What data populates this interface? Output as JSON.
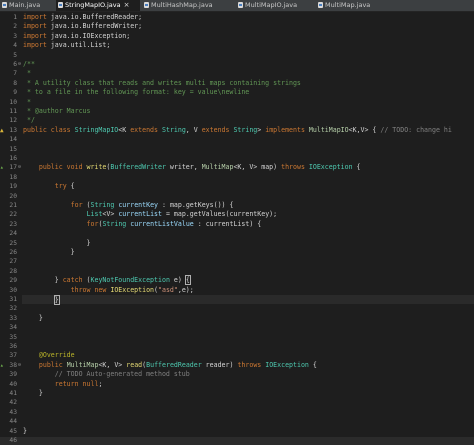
{
  "tabs": [
    {
      "label": "Main.java",
      "active": false
    },
    {
      "label": "StringMapIO.java",
      "active": true
    },
    {
      "label": "MultiHashMap.java",
      "active": false
    },
    {
      "label": "MultiMapIO.java",
      "active": false
    },
    {
      "label": "MultiMap.java",
      "active": false
    }
  ],
  "lines": [
    {
      "n": "1",
      "segs": [
        [
          "kw",
          "import "
        ],
        [
          "t",
          "java.io.BufferedReader;"
        ]
      ]
    },
    {
      "n": "2",
      "segs": [
        [
          "kw",
          "import "
        ],
        [
          "t",
          "java.io.BufferedWriter;"
        ]
      ]
    },
    {
      "n": "3",
      "segs": [
        [
          "kw",
          "import "
        ],
        [
          "t",
          "java.io.IOException;"
        ]
      ]
    },
    {
      "n": "4",
      "segs": [
        [
          "kw",
          "import "
        ],
        [
          "t",
          "java.util.List;"
        ]
      ]
    },
    {
      "n": "5",
      "segs": []
    },
    {
      "n": "6",
      "segs": [
        [
          "jd",
          "/**"
        ]
      ]
    },
    {
      "n": "7",
      "segs": [
        [
          "jd",
          " *"
        ]
      ]
    },
    {
      "n": "8",
      "segs": [
        [
          "jd",
          " * A utility class that reads and writes multi maps containing strings"
        ]
      ]
    },
    {
      "n": "9",
      "segs": [
        [
          "jd",
          " * to a file in the following format: key = value\\newline"
        ]
      ]
    },
    {
      "n": "10",
      "segs": [
        [
          "jd",
          " *"
        ]
      ]
    },
    {
      "n": "11",
      "segs": [
        [
          "jd",
          " * @author Marcus"
        ]
      ]
    },
    {
      "n": "12",
      "segs": [
        [
          "jd",
          " */"
        ]
      ]
    },
    {
      "n": "13",
      "segs": [
        [
          "kw",
          "public class "
        ],
        [
          "cl",
          "StringMapIO"
        ],
        [
          "t",
          "<K "
        ],
        [
          "kw",
          "extends "
        ],
        [
          "cl",
          "String"
        ],
        [
          "t",
          ", V "
        ],
        [
          "kw",
          "extends "
        ],
        [
          "cl",
          "String"
        ],
        [
          "t",
          "> "
        ],
        [
          "kw",
          "implements "
        ],
        [
          "cl2",
          "MultiMapIO"
        ],
        [
          "t",
          "<K,V> { "
        ],
        [
          "cm",
          "// TODO: change hi"
        ]
      ]
    },
    {
      "n": "14",
      "segs": []
    },
    {
      "n": "15",
      "segs": []
    },
    {
      "n": "16",
      "segs": []
    },
    {
      "n": "17",
      "segs": [
        [
          "t",
          "    "
        ],
        [
          "kw",
          "public void "
        ],
        [
          "fn",
          "write"
        ],
        [
          "t",
          "("
        ],
        [
          "cl",
          "BufferedWriter"
        ],
        [
          "t",
          " writer, "
        ],
        [
          "cl2",
          "MultiMap"
        ],
        [
          "t",
          "<K, V> map) "
        ],
        [
          "kw",
          "throws "
        ],
        [
          "cl",
          "IOException"
        ],
        [
          "t",
          " {"
        ]
      ]
    },
    {
      "n": "18",
      "segs": []
    },
    {
      "n": "19",
      "segs": [
        [
          "t",
          "        "
        ],
        [
          "kw",
          "try "
        ],
        [
          "t",
          "{"
        ]
      ]
    },
    {
      "n": "20",
      "segs": []
    },
    {
      "n": "21",
      "segs": [
        [
          "t",
          "            "
        ],
        [
          "kw",
          "for "
        ],
        [
          "t",
          "("
        ],
        [
          "cl",
          "String"
        ],
        [
          "t",
          " "
        ],
        [
          "var",
          "currentKey"
        ],
        [
          "t",
          " : map.getKeys()) {"
        ]
      ]
    },
    {
      "n": "22",
      "segs": [
        [
          "t",
          "                "
        ],
        [
          "cl",
          "List"
        ],
        [
          "t",
          "<V> "
        ],
        [
          "var",
          "currentList"
        ],
        [
          "t",
          " = map.getValues(currentKey);"
        ]
      ]
    },
    {
      "n": "23",
      "segs": [
        [
          "t",
          "                "
        ],
        [
          "kw",
          "for"
        ],
        [
          "t",
          "("
        ],
        [
          "cl",
          "String"
        ],
        [
          "t",
          " "
        ],
        [
          "var",
          "currentListValue"
        ],
        [
          "t",
          " : currentList) {"
        ]
      ]
    },
    {
      "n": "24",
      "segs": []
    },
    {
      "n": "25",
      "segs": [
        [
          "t",
          "                }"
        ]
      ]
    },
    {
      "n": "26",
      "segs": [
        [
          "t",
          "            }"
        ]
      ]
    },
    {
      "n": "27",
      "segs": []
    },
    {
      "n": "28",
      "segs": []
    },
    {
      "n": "29",
      "segs": [
        [
          "t",
          "        } "
        ],
        [
          "kw",
          "catch "
        ],
        [
          "t",
          "("
        ],
        [
          "cl",
          "KeyNotFoundException"
        ],
        [
          "t",
          " e) "
        ],
        [
          "brk",
          "{"
        ]
      ]
    },
    {
      "n": "30",
      "segs": [
        [
          "t",
          "            "
        ],
        [
          "kw",
          "throw new "
        ],
        [
          "fn",
          "IOException"
        ],
        [
          "t",
          "("
        ],
        [
          "st",
          "\"asd\""
        ],
        [
          "t",
          ",e);"
        ]
      ]
    },
    {
      "n": "31",
      "segs": [
        [
          "t",
          "        "
        ],
        [
          "brk",
          "}"
        ],
        [
          "cur",
          ""
        ]
      ]
    },
    {
      "n": "32",
      "segs": []
    },
    {
      "n": "33",
      "segs": [
        [
          "t",
          "    }"
        ]
      ]
    },
    {
      "n": "34",
      "segs": []
    },
    {
      "n": "35",
      "segs": []
    },
    {
      "n": "36",
      "segs": []
    },
    {
      "n": "37",
      "segs": [
        [
          "t",
          "    "
        ],
        [
          "ann",
          "@Override"
        ]
      ]
    },
    {
      "n": "38",
      "segs": [
        [
          "t",
          "    "
        ],
        [
          "kw",
          "public "
        ],
        [
          "cl2",
          "MultiMap"
        ],
        [
          "t",
          "<K, V> "
        ],
        [
          "fn",
          "read"
        ],
        [
          "t",
          "("
        ],
        [
          "cl",
          "BufferedReader"
        ],
        [
          "t",
          " reader) "
        ],
        [
          "kw",
          "throws "
        ],
        [
          "cl",
          "IOException"
        ],
        [
          "t",
          " {"
        ]
      ]
    },
    {
      "n": "39",
      "segs": [
        [
          "t",
          "        "
        ],
        [
          "cm",
          "// TODO Auto-generated method stub"
        ]
      ]
    },
    {
      "n": "40",
      "segs": [
        [
          "t",
          "        "
        ],
        [
          "kw",
          "return null"
        ],
        [
          "t",
          ";"
        ]
      ]
    },
    {
      "n": "41",
      "segs": [
        [
          "t",
          "    }"
        ]
      ]
    },
    {
      "n": "42",
      "segs": []
    },
    {
      "n": "43",
      "segs": []
    },
    {
      "n": "44",
      "segs": []
    },
    {
      "n": "45",
      "segs": [
        [
          "t",
          "}"
        ]
      ]
    },
    {
      "n": "46",
      "segs": []
    }
  ],
  "markers": {
    "13": "warning-icon",
    "17": "override-icon",
    "38": "override-icon"
  },
  "folds": [
    "6",
    "17",
    "38"
  ],
  "colors": {
    "editor_bg": "#1e1e1e",
    "tabbar_bg": "#3c3f41",
    "keyword": "#cc7832",
    "javadoc": "#629755",
    "comment": "#808080",
    "type": "#4ec9b0"
  }
}
